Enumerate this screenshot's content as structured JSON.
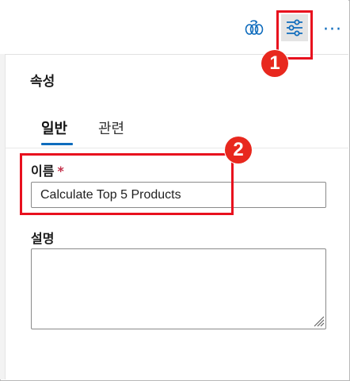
{
  "toolbar": {
    "icons": [
      {
        "name": "workflow-bots-icon"
      },
      {
        "name": "properties-sliders-icon"
      }
    ],
    "more_label": "···"
  },
  "colors": {
    "accent": "#0f6cbd",
    "callout": "#e8101e",
    "required": "#c4314b"
  },
  "callouts": [
    "1",
    "2"
  ],
  "panel": {
    "title": "속성",
    "tabs": [
      {
        "label": "일반",
        "selected": true
      },
      {
        "label": "관련",
        "selected": false
      }
    ],
    "name_field": {
      "label": "이름",
      "required_mark": "*",
      "value": "Calculate Top 5 Products"
    },
    "description_field": {
      "label": "설명",
      "value": ""
    }
  }
}
